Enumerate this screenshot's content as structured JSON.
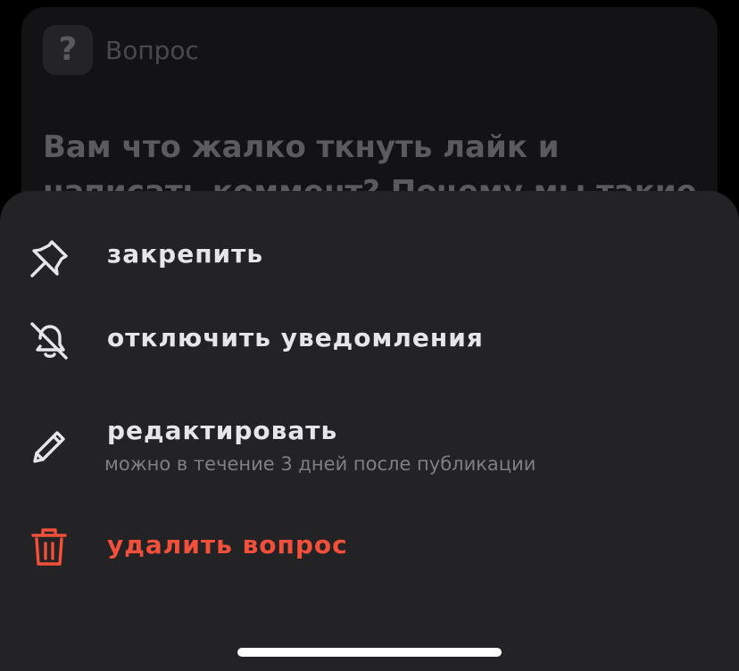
{
  "background_card": {
    "badge_glyph": "?",
    "label": "Вопрос",
    "question_text": "Вам что жалко ткнуть лайк и написать коммент? Почему мы такие чёрствые в"
  },
  "sheet": {
    "items": [
      {
        "label": "закрепить",
        "icon": "pin-icon"
      },
      {
        "label": "отключить уведомления",
        "icon": "bell-off-icon"
      },
      {
        "label": "редактировать",
        "sublabel": "можно в течение 3 дней после публикации",
        "icon": "pencil-icon"
      },
      {
        "label": "удалить вопрос",
        "icon": "trash-icon"
      }
    ]
  },
  "colors": {
    "sheet_background": "#232325",
    "text_primary": "#e6e6ea",
    "text_secondary": "#7f7f85",
    "danger": "#f2503a"
  }
}
